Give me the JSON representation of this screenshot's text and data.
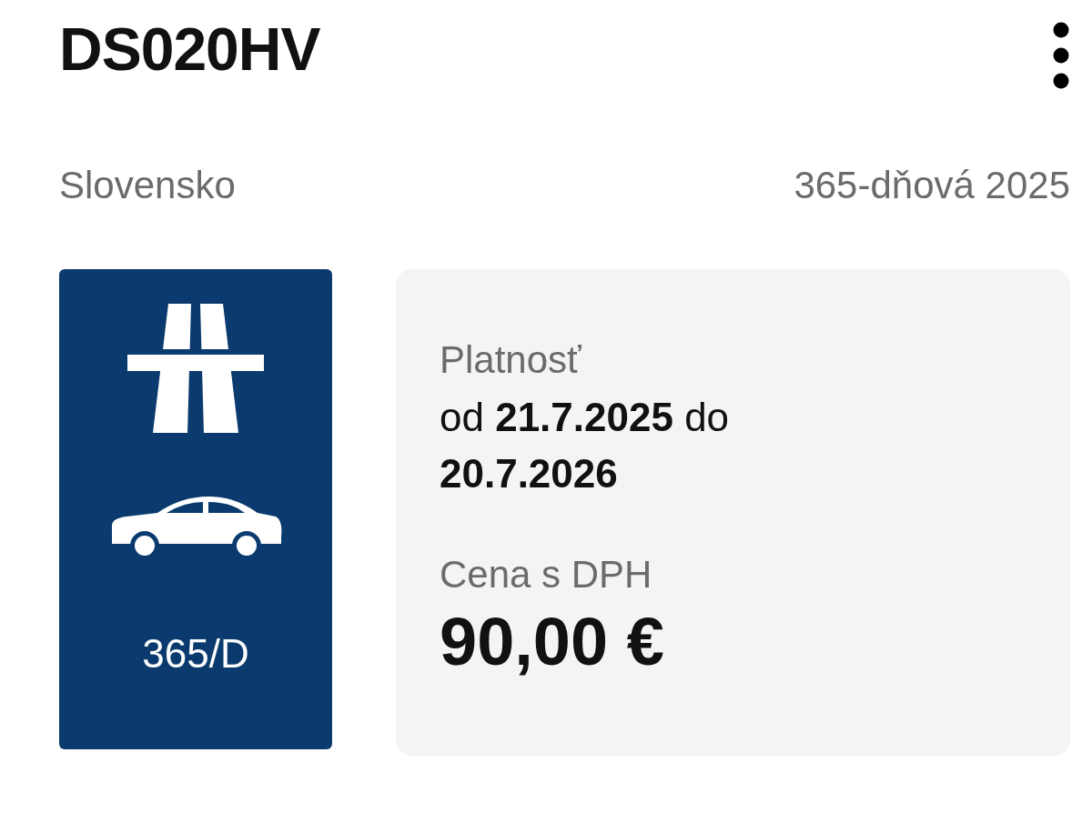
{
  "header": {
    "title": "DS020HV"
  },
  "vignette": {
    "country": "Slovensko",
    "type": "365-dňová 2025",
    "badge": {
      "label": "365/D"
    },
    "validity": {
      "label": "Platnosť",
      "text": "od **21.7.2025** do **20.7.2026**"
    },
    "price": {
      "label": "Cena s DPH",
      "value": "90,00 €"
    }
  }
}
